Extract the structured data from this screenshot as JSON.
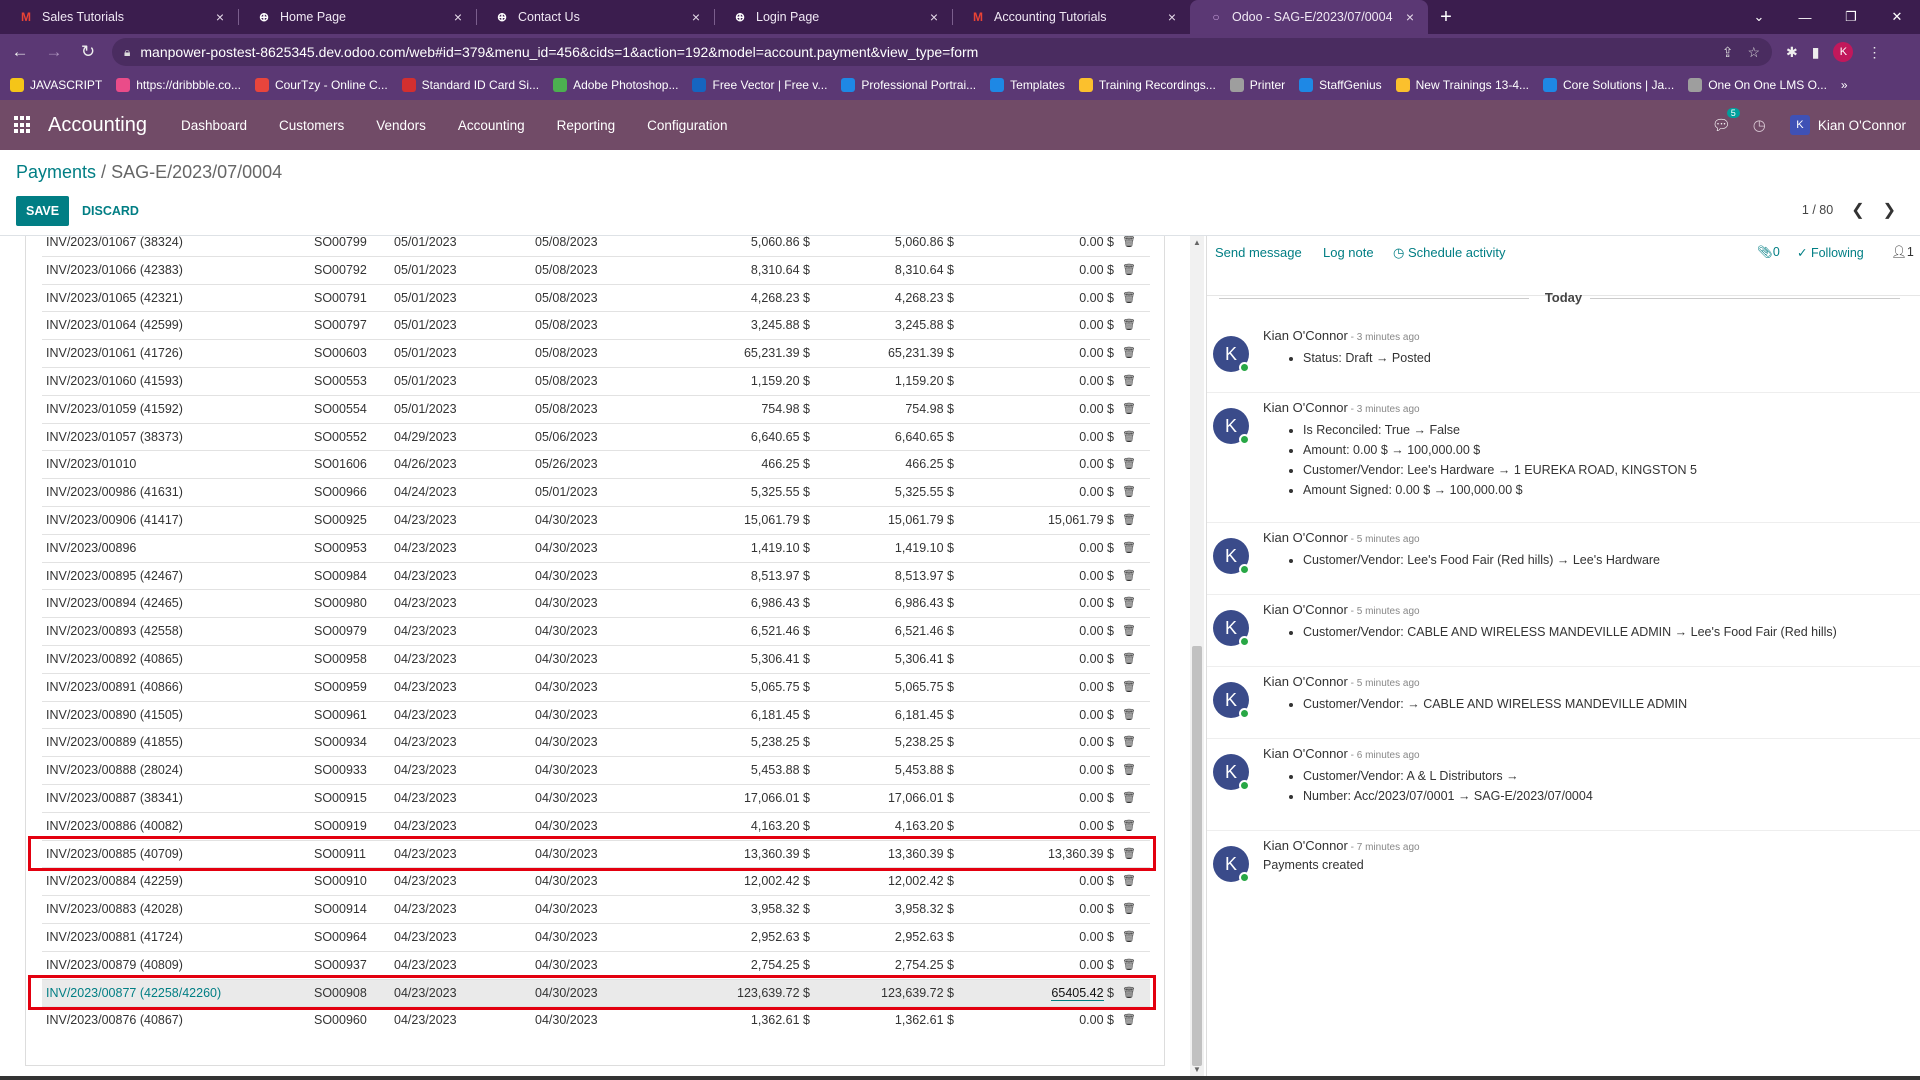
{
  "browser": {
    "tabs": [
      {
        "title": "Sales Tutorials",
        "icon": "gmail-icon",
        "color": "#ea4335"
      },
      {
        "title": "Home Page",
        "icon": "globe-icon",
        "color": "#ffffff"
      },
      {
        "title": "Contact Us",
        "icon": "globe-icon",
        "color": "#ffffff"
      },
      {
        "title": "Login Page",
        "icon": "globe-icon",
        "color": "#ffffff"
      },
      {
        "title": "Accounting Tutorials",
        "icon": "gmail-icon",
        "color": "#ea4335"
      },
      {
        "title": "Odoo - SAG-E/2023/07/0004",
        "icon": "odoo-icon",
        "color": "#c9a0dc"
      }
    ],
    "url": "manpower-postest-8625345.dev.odoo.com/web#id=379&menu_id=456&cids=1&action=192&model=account.payment&view_type=form",
    "profile_letter": "K",
    "bookmarks": [
      {
        "label": "JAVASCRIPT",
        "color": "#f5c518"
      },
      {
        "label": "https://dribbble.co...",
        "color": "#ea4c89"
      },
      {
        "label": "CourTzy - Online C...",
        "color": "#e8453c"
      },
      {
        "label": "Standard ID Card Si...",
        "color": "#d32f2f"
      },
      {
        "label": "Adobe Photoshop...",
        "color": "#4caf50"
      },
      {
        "label": "Free Vector | Free v...",
        "color": "#1565c0"
      },
      {
        "label": "Professional Portrai...",
        "color": "#1e88e5"
      },
      {
        "label": "Templates",
        "color": "#1e88e5"
      },
      {
        "label": "Training Recordings...",
        "color": "#fbc02d"
      },
      {
        "label": "Printer",
        "color": "#9e9e9e"
      },
      {
        "label": "StaffGenius",
        "color": "#1e88e5"
      },
      {
        "label": "New Trainings 13-4...",
        "color": "#fbc02d"
      },
      {
        "label": "Core Solutions | Ja...",
        "color": "#1e88e5"
      },
      {
        "label": "One On One LMS O...",
        "color": "#9e9e9e"
      }
    ]
  },
  "odoo": {
    "app_name": "Accounting",
    "menu": [
      "Dashboard",
      "Customers",
      "Vendors",
      "Accounting",
      "Reporting",
      "Configuration"
    ],
    "chat_count": "5",
    "user_initial": "K",
    "user_name": "Kian O'Connor"
  },
  "breadcrumb": {
    "parent": "Payments",
    "sep": " / ",
    "current": "SAG-E/2023/07/0004"
  },
  "buttons": {
    "save": "SAVE",
    "discard": "DISCARD"
  },
  "pager": {
    "text": "1 / 80"
  },
  "invoice_rows": [
    {
      "inv": "INV/2023/01067 (38324)",
      "so": "SO00799",
      "d1": "05/01/2023",
      "d2": "05/08/2023",
      "a1": "5,060.86 $",
      "a2": "5,060.86 $",
      "a3": "0.00 $"
    },
    {
      "inv": "INV/2023/01066 (42383)",
      "so": "SO00792",
      "d1": "05/01/2023",
      "d2": "05/08/2023",
      "a1": "8,310.64 $",
      "a2": "8,310.64 $",
      "a3": "0.00 $"
    },
    {
      "inv": "INV/2023/01065 (42321)",
      "so": "SO00791",
      "d1": "05/01/2023",
      "d2": "05/08/2023",
      "a1": "4,268.23 $",
      "a2": "4,268.23 $",
      "a3": "0.00 $"
    },
    {
      "inv": "INV/2023/01064 (42599)",
      "so": "SO00797",
      "d1": "05/01/2023",
      "d2": "05/08/2023",
      "a1": "3,245.88 $",
      "a2": "3,245.88 $",
      "a3": "0.00 $"
    },
    {
      "inv": "INV/2023/01061 (41726)",
      "so": "SO00603",
      "d1": "05/01/2023",
      "d2": "05/08/2023",
      "a1": "65,231.39 $",
      "a2": "65,231.39 $",
      "a3": "0.00 $"
    },
    {
      "inv": "INV/2023/01060 (41593)",
      "so": "SO00553",
      "d1": "05/01/2023",
      "d2": "05/08/2023",
      "a1": "1,159.20 $",
      "a2": "1,159.20 $",
      "a3": "0.00 $"
    },
    {
      "inv": "INV/2023/01059 (41592)",
      "so": "SO00554",
      "d1": "05/01/2023",
      "d2": "05/08/2023",
      "a1": "754.98 $",
      "a2": "754.98 $",
      "a3": "0.00 $"
    },
    {
      "inv": "INV/2023/01057 (38373)",
      "so": "SO00552",
      "d1": "04/29/2023",
      "d2": "05/06/2023",
      "a1": "6,640.65 $",
      "a2": "6,640.65 $",
      "a3": "0.00 $"
    },
    {
      "inv": "INV/2023/01010",
      "so": "SO01606",
      "d1": "04/26/2023",
      "d2": "05/26/2023",
      "a1": "466.25 $",
      "a2": "466.25 $",
      "a3": "0.00 $"
    },
    {
      "inv": "INV/2023/00986 (41631)",
      "so": "SO00966",
      "d1": "04/24/2023",
      "d2": "05/01/2023",
      "a1": "5,325.55 $",
      "a2": "5,325.55 $",
      "a3": "0.00 $"
    },
    {
      "inv": "INV/2023/00906 (41417)",
      "so": "SO00925",
      "d1": "04/23/2023",
      "d2": "04/30/2023",
      "a1": "15,061.79 $",
      "a2": "15,061.79 $",
      "a3": "15,061.79 $"
    },
    {
      "inv": "INV/2023/00896",
      "so": "SO00953",
      "d1": "04/23/2023",
      "d2": "04/30/2023",
      "a1": "1,419.10 $",
      "a2": "1,419.10 $",
      "a3": "0.00 $"
    },
    {
      "inv": "INV/2023/00895 (42467)",
      "so": "SO00984",
      "d1": "04/23/2023",
      "d2": "04/30/2023",
      "a1": "8,513.97 $",
      "a2": "8,513.97 $",
      "a3": "0.00 $"
    },
    {
      "inv": "INV/2023/00894 (42465)",
      "so": "SO00980",
      "d1": "04/23/2023",
      "d2": "04/30/2023",
      "a1": "6,986.43 $",
      "a2": "6,986.43 $",
      "a3": "0.00 $"
    },
    {
      "inv": "INV/2023/00893 (42558)",
      "so": "SO00979",
      "d1": "04/23/2023",
      "d2": "04/30/2023",
      "a1": "6,521.46 $",
      "a2": "6,521.46 $",
      "a3": "0.00 $"
    },
    {
      "inv": "INV/2023/00892 (40865)",
      "so": "SO00958",
      "d1": "04/23/2023",
      "d2": "04/30/2023",
      "a1": "5,306.41 $",
      "a2": "5,306.41 $",
      "a3": "0.00 $"
    },
    {
      "inv": "INV/2023/00891 (40866)",
      "so": "SO00959",
      "d1": "04/23/2023",
      "d2": "04/30/2023",
      "a1": "5,065.75 $",
      "a2": "5,065.75 $",
      "a3": "0.00 $"
    },
    {
      "inv": "INV/2023/00890 (41505)",
      "so": "SO00961",
      "d1": "04/23/2023",
      "d2": "04/30/2023",
      "a1": "6,181.45 $",
      "a2": "6,181.45 $",
      "a3": "0.00 $"
    },
    {
      "inv": "INV/2023/00889 (41855)",
      "so": "SO00934",
      "d1": "04/23/2023",
      "d2": "04/30/2023",
      "a1": "5,238.25 $",
      "a2": "5,238.25 $",
      "a3": "0.00 $"
    },
    {
      "inv": "INV/2023/00888 (28024)",
      "so": "SO00933",
      "d1": "04/23/2023",
      "d2": "04/30/2023",
      "a1": "5,453.88 $",
      "a2": "5,453.88 $",
      "a3": "0.00 $"
    },
    {
      "inv": "INV/2023/00887 (38341)",
      "so": "SO00915",
      "d1": "04/23/2023",
      "d2": "04/30/2023",
      "a1": "17,066.01 $",
      "a2": "17,066.01 $",
      "a3": "0.00 $"
    },
    {
      "inv": "INV/2023/00886 (40082)",
      "so": "SO00919",
      "d1": "04/23/2023",
      "d2": "04/30/2023",
      "a1": "4,163.20 $",
      "a2": "4,163.20 $",
      "a3": "0.00 $"
    },
    {
      "inv": "INV/2023/00885 (40709)",
      "so": "SO00911",
      "d1": "04/23/2023",
      "d2": "04/30/2023",
      "a1": "13,360.39 $",
      "a2": "13,360.39 $",
      "a3": "13,360.39 $"
    },
    {
      "inv": "INV/2023/00884 (42259)",
      "so": "SO00910",
      "d1": "04/23/2023",
      "d2": "04/30/2023",
      "a1": "12,002.42 $",
      "a2": "12,002.42 $",
      "a3": "0.00 $"
    },
    {
      "inv": "INV/2023/00883 (42028)",
      "so": "SO00914",
      "d1": "04/23/2023",
      "d2": "04/30/2023",
      "a1": "3,958.32 $",
      "a2": "3,958.32 $",
      "a3": "0.00 $"
    },
    {
      "inv": "INV/2023/00881 (41724)",
      "so": "SO00964",
      "d1": "04/23/2023",
      "d2": "04/30/2023",
      "a1": "2,952.63 $",
      "a2": "2,952.63 $",
      "a3": "0.00 $"
    },
    {
      "inv": "INV/2023/00879 (40809)",
      "so": "SO00937",
      "d1": "04/23/2023",
      "d2": "04/30/2023",
      "a1": "2,754.25 $",
      "a2": "2,754.25 $",
      "a3": "0.00 $"
    },
    {
      "inv": "INV/2023/00877 (42258/42260)",
      "so": "SO00908",
      "d1": "04/23/2023",
      "d2": "04/30/2023",
      "a1": "123,639.72 $",
      "a2": "123,639.72 $",
      "a3_value": "65405.42",
      "a3_unit": " $"
    },
    {
      "inv": "INV/2023/00876 (40867)",
      "so": "SO00960",
      "d1": "04/23/2023",
      "d2": "04/30/2023",
      "a1": "1,362.61 $",
      "a2": "1,362.61 $",
      "a3": "0.00 $"
    }
  ],
  "highlight_color": "#e3000f",
  "chatter": {
    "send_message": "Send message",
    "log_note": "Log note",
    "schedule_activity": "Schedule activity",
    "attachments": "0",
    "following": "Following",
    "followers": "1",
    "today": "Today",
    "messages": [
      {
        "author": "Kian O'Connor",
        "time": " - 3 minutes ago",
        "lines": [
          "Status: Draft → Posted"
        ]
      },
      {
        "author": "Kian O'Connor",
        "time": " - 3 minutes ago",
        "lines": [
          "Is Reconciled: True → False",
          "Amount: 0.00 $ → 100,000.00 $",
          "Customer/Vendor: Lee's Hardware → 1 EUREKA ROAD, KINGSTON 5",
          "Amount Signed: 0.00 $ → 100,000.00 $"
        ]
      },
      {
        "author": "Kian O'Connor",
        "time": " - 5 minutes ago",
        "lines": [
          "Customer/Vendor: Lee's Food Fair (Red hills) → Lee's Hardware"
        ]
      },
      {
        "author": "Kian O'Connor",
        "time": " - 5 minutes ago",
        "lines": [
          "Customer/Vendor: CABLE AND WIRELESS MANDEVILLE ADMIN → Lee's Food Fair (Red hills)"
        ]
      },
      {
        "author": "Kian O'Connor",
        "time": " - 5 minutes ago",
        "lines": [
          "Customer/Vendor: → CABLE AND WIRELESS MANDEVILLE ADMIN"
        ]
      },
      {
        "author": "Kian O'Connor",
        "time": " - 6 minutes ago",
        "lines": [
          "Customer/Vendor: A & L Distributors →",
          "Number: Acc/2023/07/0001 → SAG-E/2023/07/0004"
        ]
      },
      {
        "author": "Kian O'Connor",
        "time": " - 7 minutes ago",
        "plain": "Payments created"
      }
    ]
  }
}
